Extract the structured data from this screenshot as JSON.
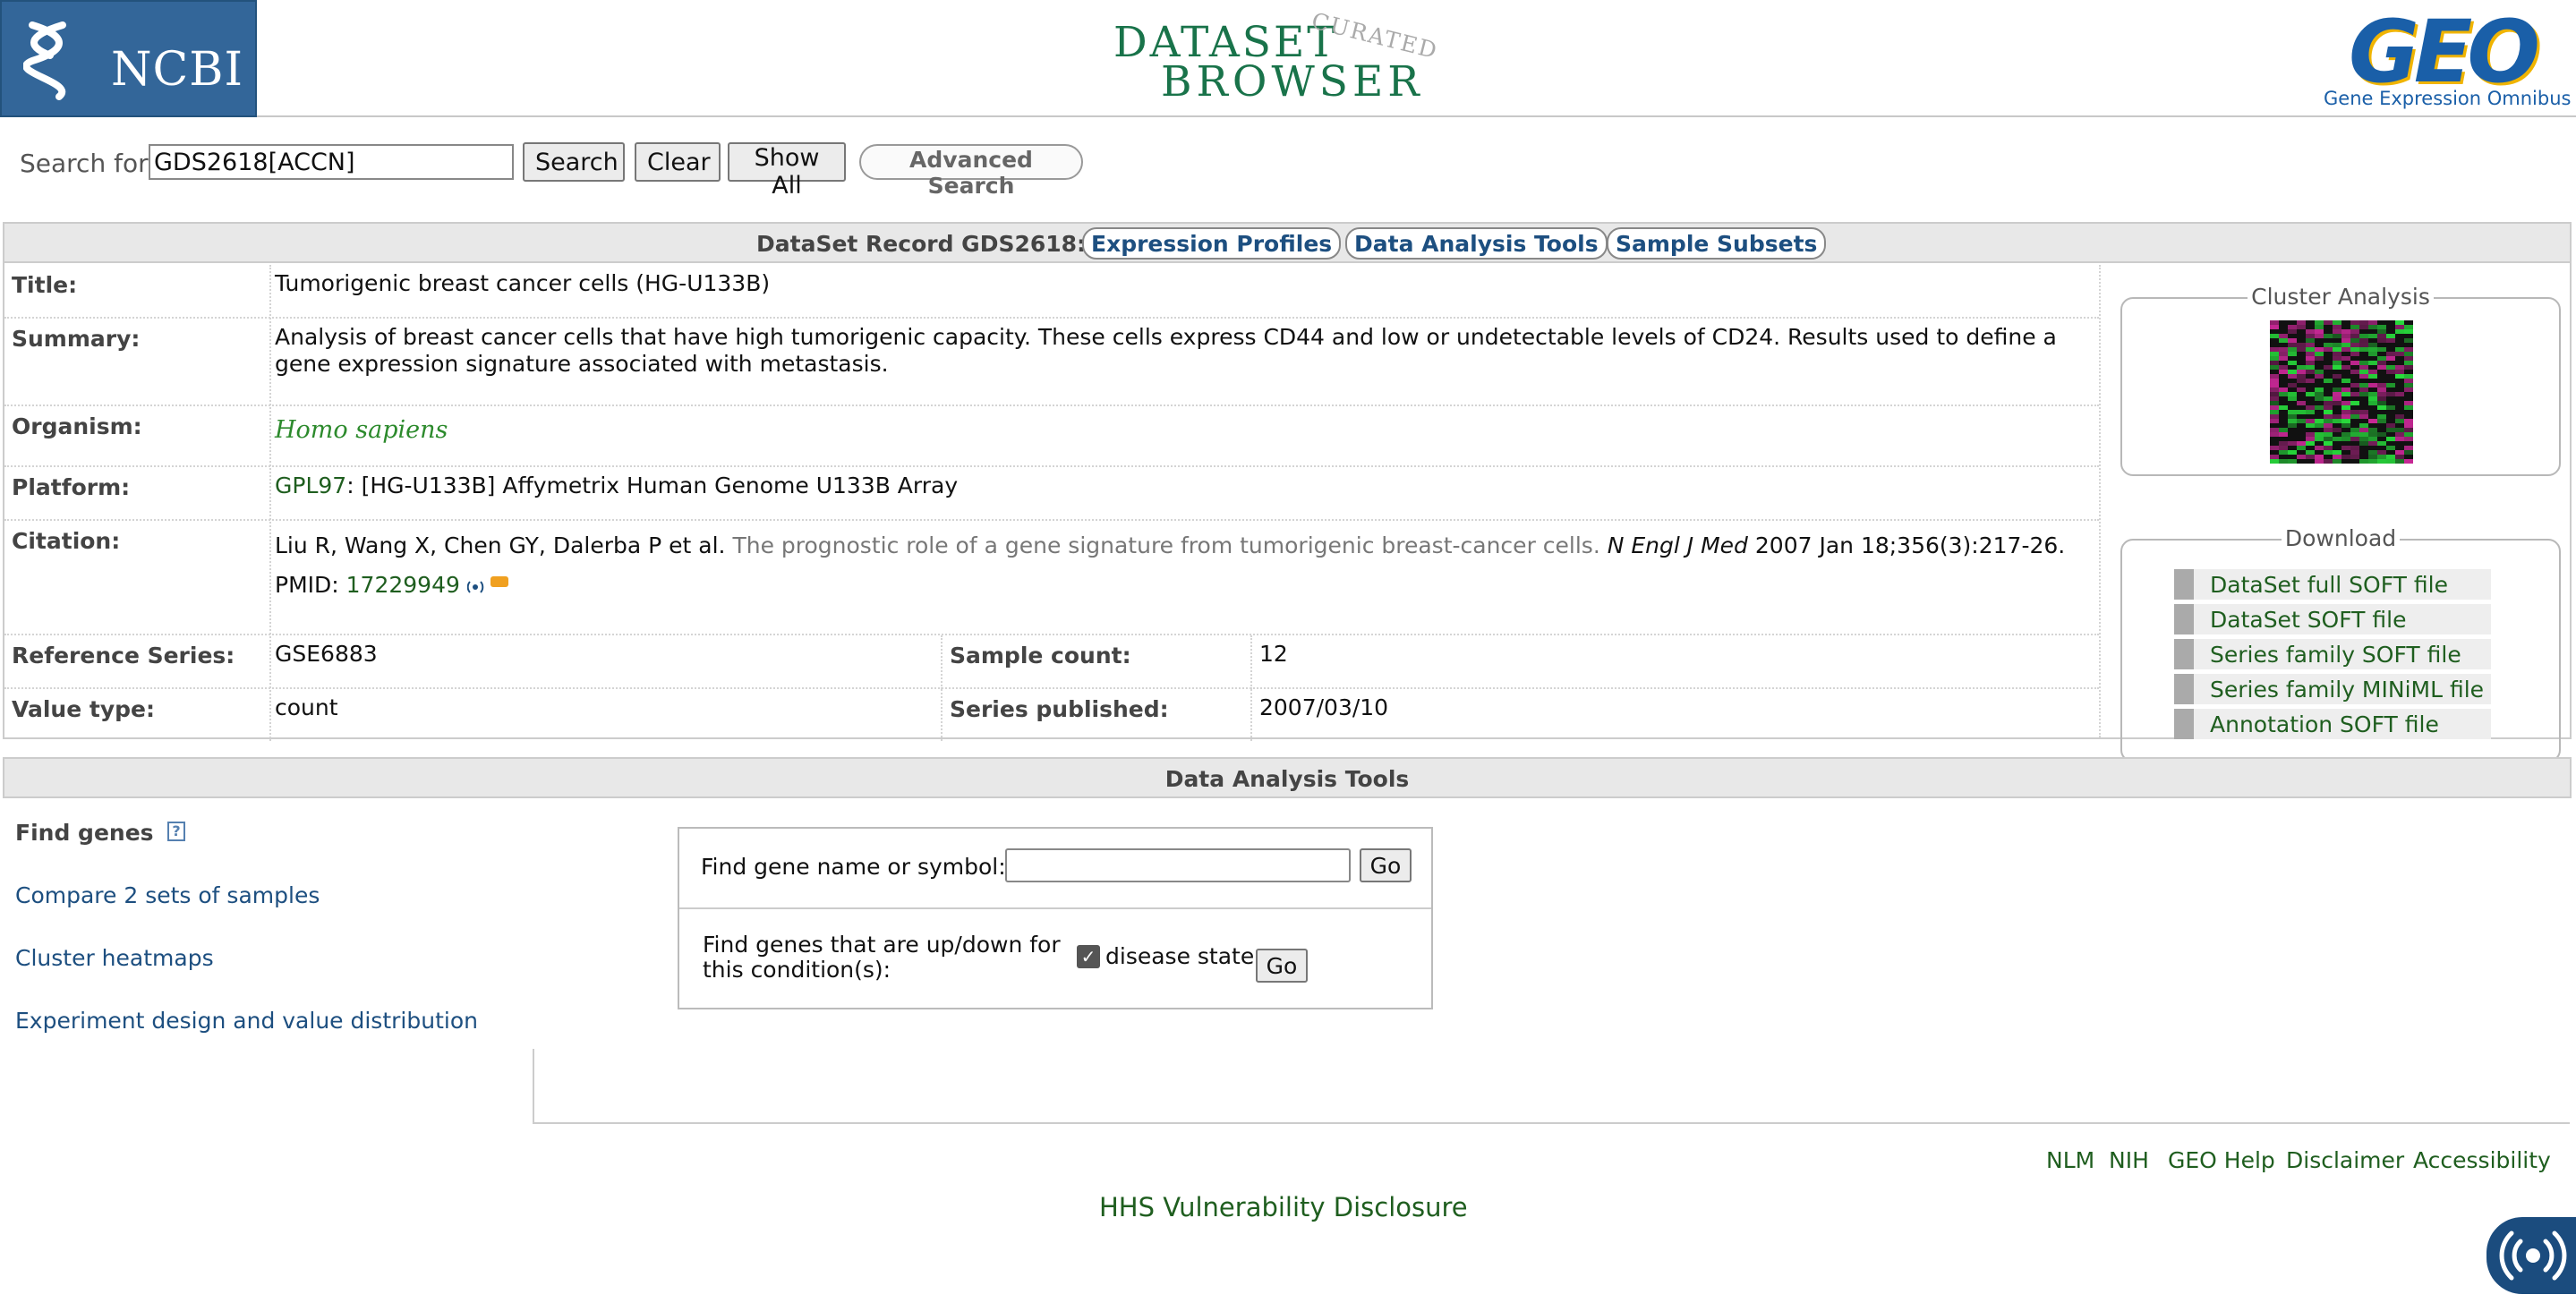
{
  "header": {
    "ncbi_logo_text": "NCBI",
    "dataset_browser_line1": "DATASET",
    "dataset_browser_line2": "BROWSER",
    "dataset_browser_curated": "CURATED",
    "geo_logo_text": "GEO",
    "geo_subtitle": "Gene Expression Omnibus"
  },
  "search": {
    "label": "Search for",
    "value": "GDS2618[ACCN]",
    "search_label": "Search",
    "clear_label": "Clear",
    "show_all_label": "Show All",
    "advanced_label": "Advanced Search"
  },
  "record": {
    "title": "DataSet Record GDS2618:",
    "tabs": [
      "Expression Profiles",
      "Data Analysis Tools",
      "Sample Subsets"
    ],
    "fields": {
      "title_label": "Title:",
      "title_value": "Tumorigenic breast cancer cells (HG-U133B)",
      "summary_label": "Summary:",
      "summary_value": "Analysis of breast cancer cells that have high tumorigenic capacity. These cells express CD44 and low or undetectable levels of CD24. Results used to define a gene expression signature associated with metastasis.",
      "organism_label": "Organism:",
      "organism_value": "Homo sapiens",
      "platform_label": "Platform:",
      "platform_link": "GPL97",
      "platform_text": ": [HG-U133B] Affymetrix Human Genome U133B Array",
      "citation_label": "Citation:",
      "citation_authors": "Liu R, Wang X, Chen GY, Dalerba P et al.",
      "citation_title": "The prognostic role of a gene signature from tumorigenic breast-cancer cells.",
      "citation_journal": "N Engl J Med",
      "citation_date": "2007 Jan 18;356(3):217-26.",
      "pmid_label": "PMID:",
      "pmid_value": "17229949",
      "reference_series_label": "Reference Series:",
      "reference_series_value": "GSE6883",
      "sample_count_label": "Sample count:",
      "sample_count_value": "12",
      "value_type_label": "Value type:",
      "value_type_value": "count",
      "series_published_label": "Series published:",
      "series_published_value": "2007/03/10"
    },
    "cluster_analysis_label": "Cluster Analysis",
    "download_label": "Download",
    "downloads": [
      "DataSet full SOFT file",
      "DataSet SOFT file",
      "Series family SOFT file",
      "Series family MINiML file",
      "Annotation SOFT file"
    ]
  },
  "tools": {
    "header": "Data Analysis Tools",
    "find_genes_label": "Find genes",
    "help_icon": "?",
    "menu": [
      "Compare 2 sets of samples",
      "Cluster heatmaps",
      "Experiment design and value distribution"
    ],
    "gene_search_label": "Find gene name or symbol:",
    "gene_search_value": "",
    "go_label": "Go",
    "updown_label": "Find genes that are up/down for this condition(s):",
    "condition_label": "disease state",
    "condition_checked": true
  },
  "footer": {
    "links": [
      "NLM",
      "NIH",
      "GEO Help",
      "Disclaimer",
      "Accessibility"
    ],
    "hhs_link": "HHS Vulnerability Disclosure"
  },
  "colors": {
    "ncbi_blue": "#336699",
    "link_green": "#1f5e1f",
    "link_blue": "#1d4f80",
    "header_gray": "#e8e8e8"
  }
}
